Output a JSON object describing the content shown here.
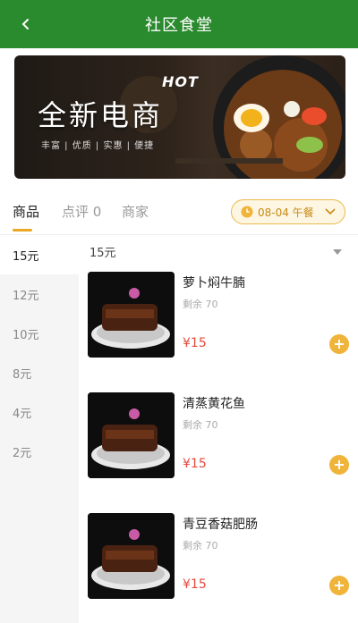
{
  "header": {
    "title": "社区食堂",
    "back_icon": "chevron-left-icon"
  },
  "banner": {
    "headline": "全新电商",
    "hot_label": "HOT",
    "tagline": "丰富 | 优质 | 实惠 | 便捷"
  },
  "tabs": [
    {
      "label": "商品",
      "active": true
    },
    {
      "label": "点评 0",
      "active": false
    },
    {
      "label": "商家",
      "active": false
    }
  ],
  "meal_select": {
    "label": "08-04 午餐",
    "icon": "clock-icon"
  },
  "sidebar": {
    "items": [
      {
        "label": "15元",
        "active": true
      },
      {
        "label": "12元"
      },
      {
        "label": "10元"
      },
      {
        "label": "8元"
      },
      {
        "label": "4元"
      },
      {
        "label": "2元"
      }
    ]
  },
  "category": {
    "title": "15元"
  },
  "dishes": [
    {
      "name": "萝卜焖牛腩",
      "stock": "剩余 70",
      "price": "¥15"
    },
    {
      "name": "清蒸黄花鱼",
      "stock": "剩余 70",
      "price": "¥15"
    },
    {
      "name": "青豆香菇肥肠",
      "stock": "剩余 70",
      "price": "¥15"
    }
  ],
  "colors": {
    "header": "#2a8a2e",
    "accent": "#f0b43a",
    "price": "#e64a3c"
  }
}
